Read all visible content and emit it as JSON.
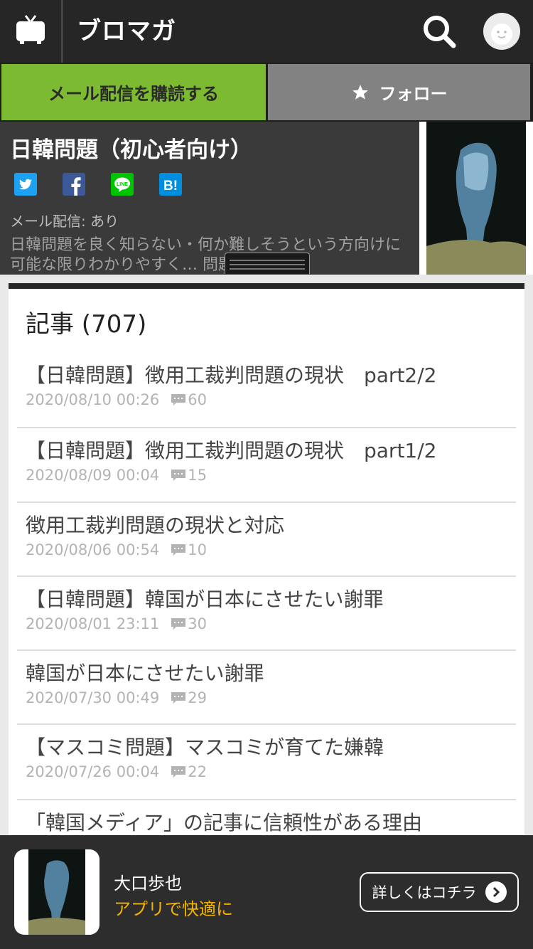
{
  "header": {
    "logo_text": "ブロマガ",
    "icons": [
      "tv-icon",
      "search-icon",
      "avatar-icon"
    ]
  },
  "actions": {
    "subscribe_label": "メール配信を購読する",
    "follow_label": "フォロー",
    "subscribe_color": "#7cba32",
    "follow_color": "#828282"
  },
  "channel": {
    "title": "日韓問題（初心者向け）",
    "mail_status": "メール配信: あり",
    "description": "日韓問題を良く知らない・何か難しそうという方向けに可能な限りわかりやすく… 問題を扱っ",
    "share": [
      {
        "name": "twitter-share-button",
        "icon": "twitter-icon",
        "color": "#1da1f2"
      },
      {
        "name": "facebook-share-button",
        "icon": "facebook-icon",
        "color": "#3b5998"
      },
      {
        "name": "line-share-button",
        "icon": "line-icon",
        "color": "#00c300"
      },
      {
        "name": "hatena-share-button",
        "icon": "hatena-bookmark-icon",
        "color": "#008fde"
      }
    ]
  },
  "articles": {
    "heading": "記事 (707)",
    "items": [
      {
        "title": "【日韓問題】徴用工裁判問題の現状　part2/2",
        "date": "2020/08/10 00:26",
        "comments": "60"
      },
      {
        "title": "【日韓問題】徴用工裁判問題の現状　part1/2",
        "date": "2020/08/09 00:04",
        "comments": "15"
      },
      {
        "title": "徴用工裁判問題の現状と対応",
        "date": "2020/08/06 00:54",
        "comments": "10"
      },
      {
        "title": "【日韓問題】韓国が日本にさせたい謝罪",
        "date": "2020/08/01 23:11",
        "comments": "30"
      },
      {
        "title": "韓国が日本にさせたい謝罪",
        "date": "2020/07/30 00:49",
        "comments": "29"
      },
      {
        "title": "【マスコミ問題】マスコミが育てた嫌韓",
        "date": "2020/07/26 00:04",
        "comments": "22"
      },
      {
        "title": "「韓国メディア」の記事に信頼性がある理由",
        "date": "",
        "comments": ""
      }
    ]
  },
  "app_banner": {
    "author": "大口歩也",
    "tagline": "アプリで快適に",
    "button_label": "詳しくはコチラ",
    "tagline_color": "#f5b400"
  }
}
